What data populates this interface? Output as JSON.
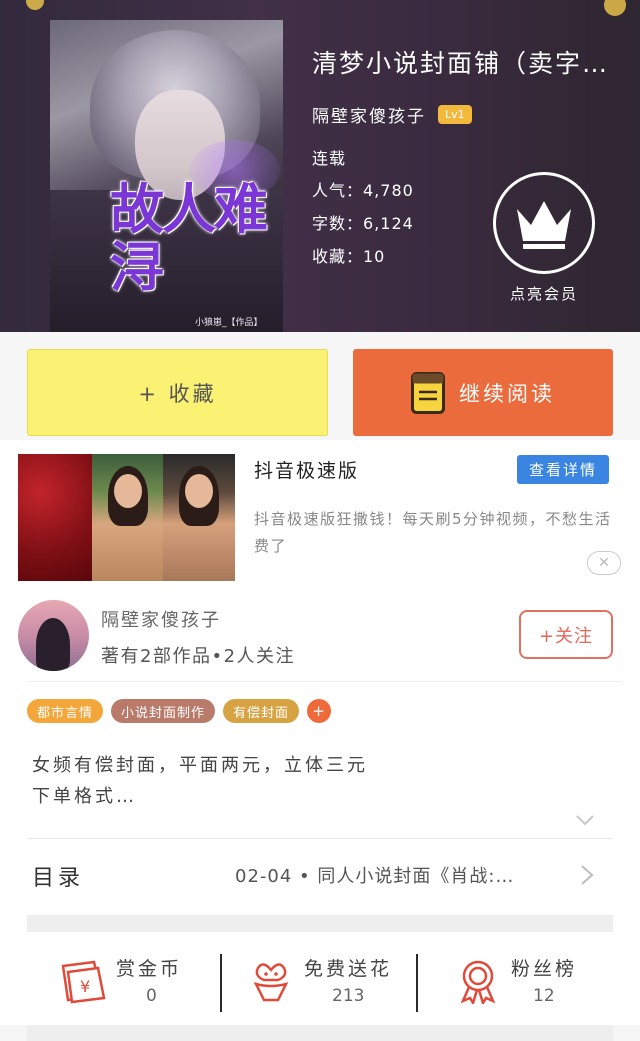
{
  "book": {
    "cover_title": "故人难浔",
    "cover_subtitle": "小狼崽_【作品】",
    "title": "清梦小说封面铺（卖字…",
    "author": "隔壁家傻孩子",
    "level_badge": "Lv1",
    "status": "连载",
    "popularity": "人气：4,780",
    "word_count": "字数：6,124",
    "favorites": "收藏：10",
    "vip_label": "点亮会员"
  },
  "actions": {
    "collect_label": "+ 收藏",
    "read_label": "继续阅读"
  },
  "ad": {
    "title": "抖音极速版",
    "button_label": "查看详情",
    "description": "抖音极速版狂撒钱！每天刷5分钟视频，不愁生活费了",
    "close_symbol": "✕"
  },
  "author_card": {
    "name": "隔壁家傻孩子",
    "meta": "著有2部作品•2人关注",
    "follow_label": "+关注"
  },
  "tags": [
    {
      "label": "都市言情",
      "color": "#f3a73a"
    },
    {
      "label": "小说封面制作",
      "color": "#b97a6a"
    },
    {
      "label": "有偿封面",
      "color": "#d7a342"
    },
    {
      "label": "+",
      "color": "#ee6a3c"
    }
  ],
  "intro": "女频有偿封面，平面两元，立体三元\n下单格式…",
  "toc": {
    "label": "目录",
    "latest": "02-04 • 同人小说封面《肖战:…"
  },
  "rewards": {
    "coins": {
      "label": "赏金币",
      "value": "0"
    },
    "flowers": {
      "label": "免费送花",
      "value": "213"
    },
    "fans": {
      "label": "粉丝榜",
      "value": "12"
    }
  },
  "colors": {
    "collect_bg": "#fbf173",
    "read_bg": "#ec6b3c",
    "ad_button": "#3a85e2",
    "follow_accent": "#e06a5a",
    "icon_red": "#e04a3a"
  }
}
